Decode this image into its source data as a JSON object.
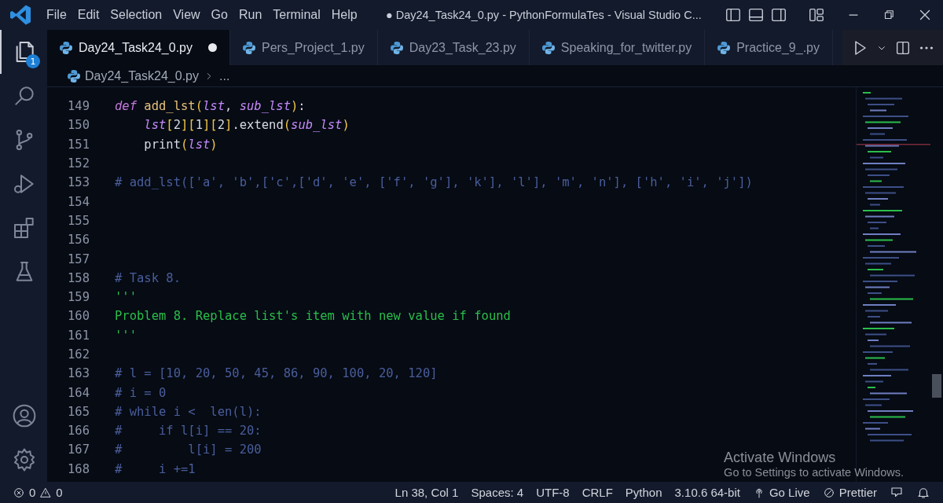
{
  "window": {
    "title": "● Day24_Task24_0.py - PythonFormulaTes - Visual Studio C..."
  },
  "menu": [
    "File",
    "Edit",
    "Selection",
    "View",
    "Go",
    "Run",
    "Terminal",
    "Help"
  ],
  "activity_bar": [
    {
      "kind": "explorer",
      "selected": true,
      "badge": "1"
    },
    {
      "kind": "search",
      "selected": false
    },
    {
      "kind": "source-control",
      "selected": false
    },
    {
      "kind": "run-debug",
      "selected": false
    },
    {
      "kind": "extensions",
      "selected": false
    },
    {
      "kind": "testing",
      "selected": false
    }
  ],
  "activity_bar_bottom": [
    {
      "kind": "account"
    },
    {
      "kind": "settings"
    }
  ],
  "tabs": [
    {
      "label": "Day24_Task24_0.py",
      "selected": true,
      "modified": true
    },
    {
      "label": "Pers_Project_1.py",
      "selected": false,
      "modified": false
    },
    {
      "label": "Day23_Task_23.py",
      "selected": false,
      "modified": false
    },
    {
      "label": "Speaking_for_twitter.py",
      "selected": false,
      "modified": false
    },
    {
      "label": "Practice_9_.py",
      "selected": false,
      "modified": false
    }
  ],
  "breadcrumb": {
    "file": "Day24_Task24_0.py",
    "rest": "..."
  },
  "code": [
    {
      "n": "149",
      "tokens": [
        {
          "kind": "keyword",
          "text": "def "
        },
        {
          "kind": "function",
          "text": "add_lst"
        },
        {
          "kind": "bracket",
          "text": "("
        },
        {
          "kind": "param",
          "text": "lst"
        },
        {
          "kind": "plain",
          "text": ", "
        },
        {
          "kind": "param",
          "text": "sub_lst"
        },
        {
          "kind": "bracket",
          "text": ")"
        },
        {
          "kind": "plain",
          "text": ":"
        }
      ]
    },
    {
      "n": "150",
      "tokens": [
        {
          "kind": "param",
          "text": "    lst"
        },
        {
          "kind": "bracket",
          "text": "["
        },
        {
          "kind": "plain",
          "text": "2"
        },
        {
          "kind": "bracket",
          "text": "]["
        },
        {
          "kind": "plain",
          "text": "1"
        },
        {
          "kind": "bracket",
          "text": "]["
        },
        {
          "kind": "plain",
          "text": "2"
        },
        {
          "kind": "bracket",
          "text": "]"
        },
        {
          "kind": "plain",
          "text": ".extend"
        },
        {
          "kind": "bracket",
          "text": "("
        },
        {
          "kind": "param",
          "text": "sub_lst"
        },
        {
          "kind": "bracket",
          "text": ")"
        }
      ]
    },
    {
      "n": "151",
      "tokens": [
        {
          "kind": "plain",
          "text": "    print"
        },
        {
          "kind": "bracket",
          "text": "("
        },
        {
          "kind": "param",
          "text": "lst"
        },
        {
          "kind": "bracket",
          "text": ")"
        }
      ]
    },
    {
      "n": "152"
    },
    {
      "n": "153",
      "tokens": [
        {
          "kind": "comment",
          "text": "# add_lst(['a', 'b',['c',['d', 'e', ['f', 'g'], 'k'], 'l'], 'm', 'n'], ['h', 'i', 'j'])"
        }
      ]
    },
    {
      "n": "154"
    },
    {
      "n": "155"
    },
    {
      "n": "156"
    },
    {
      "n": "157"
    },
    {
      "n": "158",
      "tokens": [
        {
          "kind": "comment",
          "text": "# Task 8."
        }
      ]
    },
    {
      "n": "159",
      "tokens": [
        {
          "kind": "string",
          "text": "'''"
        }
      ]
    },
    {
      "n": "160",
      "tokens": [
        {
          "kind": "string",
          "text": "Problem 8. Replace list's item with new value if found"
        }
      ]
    },
    {
      "n": "161",
      "tokens": [
        {
          "kind": "string",
          "text": "'''"
        }
      ]
    },
    {
      "n": "162"
    },
    {
      "n": "163",
      "tokens": [
        {
          "kind": "comment",
          "text": "# l = [10, 20, 50, 45, 86, 90, 100, 20, 120]"
        }
      ]
    },
    {
      "n": "164",
      "tokens": [
        {
          "kind": "comment",
          "text": "# i = 0"
        }
      ]
    },
    {
      "n": "165",
      "tokens": [
        {
          "kind": "comment",
          "text": "# while i <  len(l):"
        }
      ]
    },
    {
      "n": "166",
      "tokens": [
        {
          "kind": "comment",
          "text": "#     if l[i] == 20:"
        }
      ]
    },
    {
      "n": "167",
      "tokens": [
        {
          "kind": "comment",
          "text": "#         l[i] = 200"
        }
      ]
    },
    {
      "n": "168",
      "tokens": [
        {
          "kind": "comment",
          "text": "#     i +=1"
        }
      ]
    }
  ],
  "activation_notice": {
    "title": "Activate Windows",
    "message": "Go to Settings to activate Windows."
  },
  "status_bar": {
    "errors": "0",
    "warnings": "0",
    "items": [
      "Ln 38, Col 1",
      "Spaces: 4",
      "UTF-8",
      "CRLF",
      "Python",
      "3.10.6 64-bit"
    ],
    "go_live": "Go Live",
    "prettier": "Prettier"
  }
}
